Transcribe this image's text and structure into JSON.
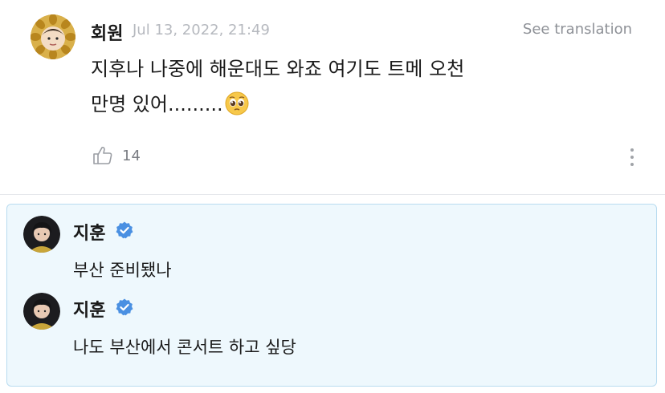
{
  "post": {
    "author": "회원",
    "timestamp": "Jul 13, 2022, 21:49",
    "translate_label": "See translation",
    "text_line1": "지후나 나중에 해운대도 와죠 여기도 트메 오천",
    "text_line2": "만명 있어.........",
    "emoji": "pleading-face-emoji",
    "like_count": "14"
  },
  "replies": [
    {
      "author": "지훈",
      "verified": true,
      "text": "부산 준비됐나"
    },
    {
      "author": "지훈",
      "verified": true,
      "text": "나도 부산에서 콘서트 하고 싶당"
    }
  ],
  "colors": {
    "reply_bg": "#eef8fd",
    "reply_border": "#b9dcf0",
    "verified_blue": "#4a90e2",
    "muted_text": "#8e9197"
  }
}
